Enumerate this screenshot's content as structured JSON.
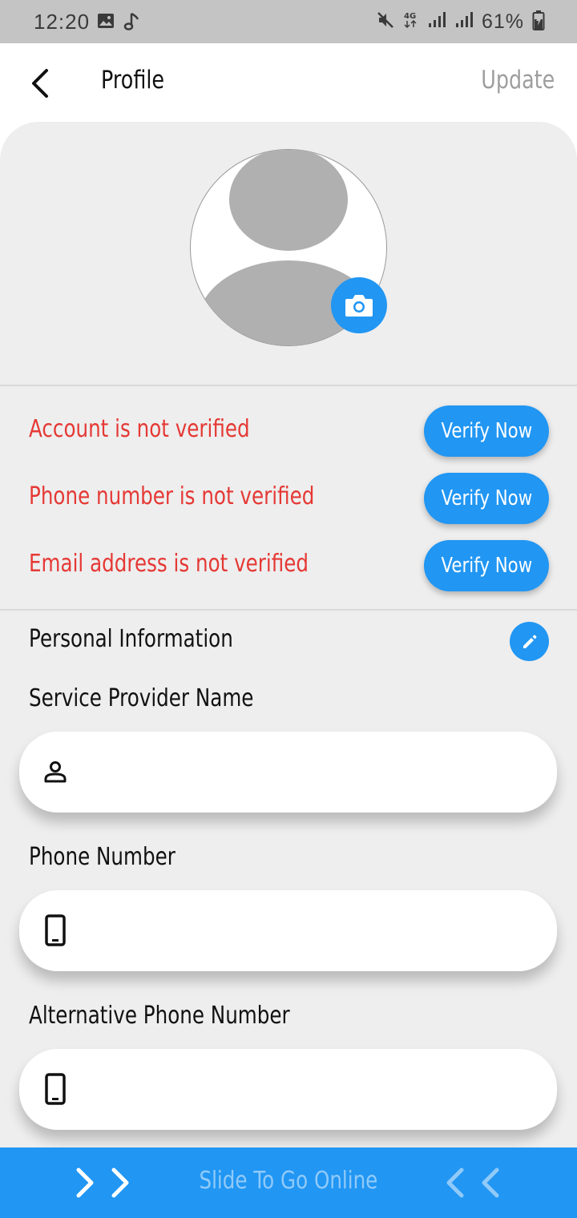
{
  "status_bar": {
    "time": "12:20",
    "battery": "61%",
    "icons": [
      "image-icon",
      "music-note-icon",
      "mute-icon",
      "4g-icon",
      "signal-icon",
      "signal-icon",
      "battery-charging-icon"
    ]
  },
  "header": {
    "back_icon": "chevron-left-icon",
    "title": "Profile",
    "action_label": "Update"
  },
  "avatar": {
    "icon": "camera-icon"
  },
  "verification": [
    {
      "message": "Account is not verified",
      "button": "Verify Now"
    },
    {
      "message": "Phone number is not verified",
      "button": "Verify Now"
    },
    {
      "message": "Email address is not verified",
      "button": "Verify Now"
    }
  ],
  "personal_info": {
    "title": "Personal Information",
    "edit_icon": "pencil-icon"
  },
  "fields": [
    {
      "label": "Service Provider Name",
      "icon": "person-icon",
      "value": ""
    },
    {
      "label": "Phone Number",
      "icon": "phone-icon",
      "value": ""
    },
    {
      "label": "Alternative Phone Number",
      "icon": "phone-icon",
      "value": ""
    }
  ],
  "bottom_bar": {
    "slide_text": "Slide To Go Online",
    "left_icon": "double-chevron-right-icon",
    "right_icon": "double-chevron-left-icon"
  },
  "colors": {
    "accent": "#2196f3",
    "error": "#e53935",
    "muted": "#9e9e9e",
    "surface": "#eeeeee"
  }
}
